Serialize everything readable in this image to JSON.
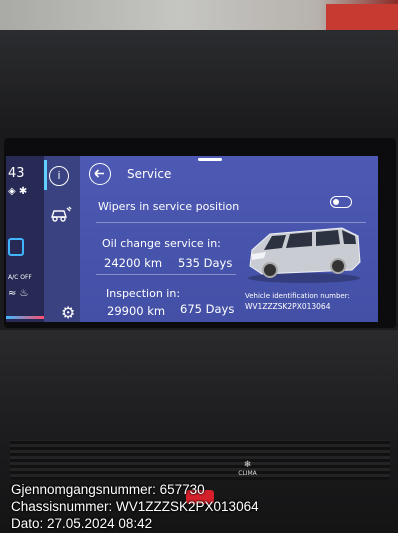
{
  "left_panel": {
    "temp_partial": "43",
    "ac_label": "A/C OFF"
  },
  "service_screen": {
    "title": "Service",
    "wipers_label": "Wipers in service position",
    "oil_change": {
      "heading": "Oil change service in:",
      "km": "24200 km",
      "days": "535 Days"
    },
    "inspection": {
      "heading": "Inspection in:",
      "km": "29900 km",
      "days": "675 Days"
    },
    "vin": {
      "label": "Vehicle identification number:",
      "value": "WV1ZZZSK2PX013064"
    }
  },
  "dashboard": {
    "clima_label": "CLIMA"
  },
  "photo_overlay": {
    "line1": "Gjennomgangsnummer: 657730",
    "line2": "Chassisnummer: WV1ZZZSK2PX013064",
    "line3": "Dato: 27.05.2024 08:42"
  },
  "icons": {
    "back": "back-arrow-icon",
    "info": "info-icon",
    "car_service": "car-service-icon",
    "settings": "gear-icon",
    "toggle": "toggle-switch"
  },
  "colors": {
    "screen_bg": "#4d59b3",
    "icon_strip": "#3a4281",
    "left_panel": "#262a55"
  }
}
